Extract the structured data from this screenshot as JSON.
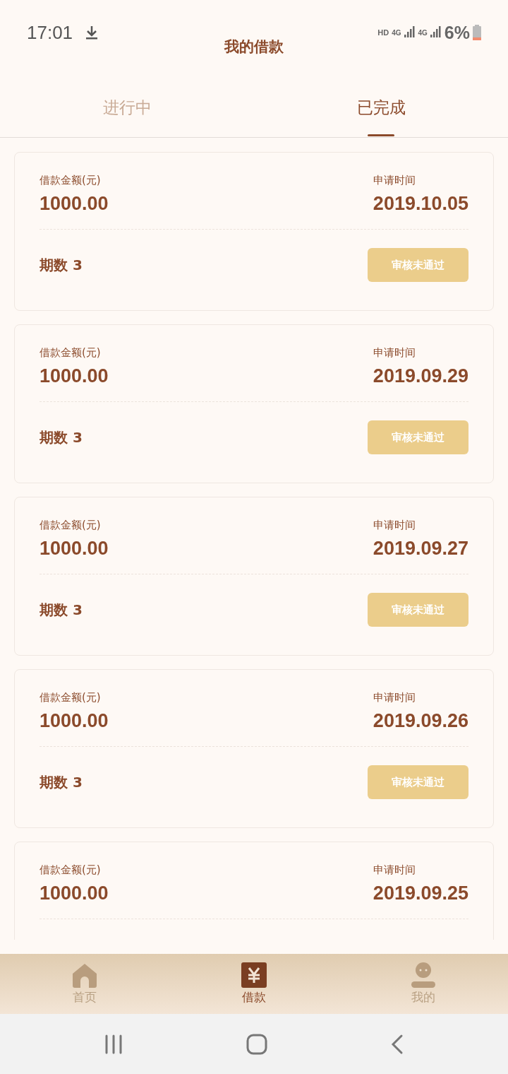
{
  "status_bar": {
    "time": "17:01",
    "hd": "HD",
    "network_1": "4G",
    "network_2": "4G",
    "battery": "6%"
  },
  "title": "我的借款",
  "tabs": [
    {
      "label": "进行中",
      "selected": false
    },
    {
      "label": "已完成",
      "selected": true
    }
  ],
  "loans": [
    {
      "amount_label": "借款金额(元)",
      "amount": "1000.00",
      "date_label": "申请时间",
      "date": "2019.10.05",
      "term_label": "期数",
      "term": "3",
      "status": "审核未通过"
    },
    {
      "amount_label": "借款金额(元)",
      "amount": "1000.00",
      "date_label": "申请时间",
      "date": "2019.09.29",
      "term_label": "期数",
      "term": "3",
      "status": "审核未通过"
    },
    {
      "amount_label": "借款金额(元)",
      "amount": "1000.00",
      "date_label": "申请时间",
      "date": "2019.09.27",
      "term_label": "期数",
      "term": "3",
      "status": "审核未通过"
    },
    {
      "amount_label": "借款金额(元)",
      "amount": "1000.00",
      "date_label": "申请时间",
      "date": "2019.09.26",
      "term_label": "期数",
      "term": "3",
      "status": "审核未通过"
    },
    {
      "amount_label": "借款金额(元)",
      "amount": "1000.00",
      "date_label": "申请时间",
      "date": "2019.09.25"
    }
  ],
  "bottom_nav": [
    {
      "kind": "home",
      "label": "首页",
      "selected": false
    },
    {
      "kind": "loan",
      "label": "借款",
      "selected": true
    },
    {
      "kind": "profile",
      "label": "我的",
      "selected": false
    }
  ]
}
